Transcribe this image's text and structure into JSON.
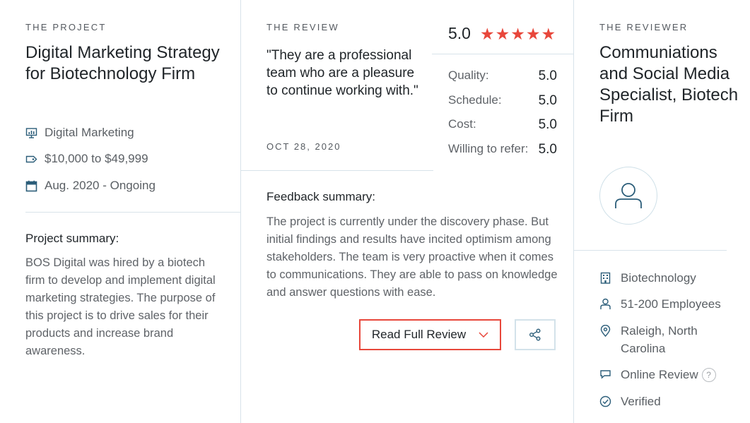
{
  "project": {
    "eyebrow": "THE PROJECT",
    "title": "Digital Marketing Strategy for Biotechnology Firm",
    "service": "Digital Marketing",
    "budget": "$10,000 to $49,999",
    "dates": "Aug. 2020 - Ongoing",
    "summary_heading": "Project summary:",
    "summary_text": "BOS Digital was hired by a biotech firm to develop and implement digital marketing strategies. The purpose of this project is to drive sales for their products and increase brand awareness."
  },
  "review": {
    "eyebrow": "THE REVIEW",
    "quote": "\"They are a professional team who are a pleasure to continue working with.\"",
    "date": "OCT 28, 2020",
    "overall": "5.0",
    "stars": 5,
    "star_color": "#e8473b",
    "ratings": [
      {
        "label": "Quality:",
        "value": "5.0"
      },
      {
        "label": "Schedule:",
        "value": "5.0"
      },
      {
        "label": "Cost:",
        "value": "5.0"
      },
      {
        "label": "Willing to refer:",
        "value": "5.0"
      }
    ],
    "feedback_heading": "Feedback summary:",
    "feedback_text": "The project is currently under the discovery phase. But initial findings and results have incited optimism among stakeholders. The team is very proactive when it comes to communications. They are able to pass on knowledge and answer questions with ease.",
    "read_button": "Read Full Review",
    "share_icon": "share-icon",
    "accent_color": "#e8473b"
  },
  "reviewer": {
    "eyebrow": "THE REVIEWER",
    "title": "Communiations and Social Media Specialist, Biotech Firm",
    "industry": "Biotechnology",
    "size": "51-200 Employees",
    "location": "Raleigh, North Carolina",
    "review_type": "Online Review",
    "help_mark": "?",
    "verified": "Verified"
  }
}
